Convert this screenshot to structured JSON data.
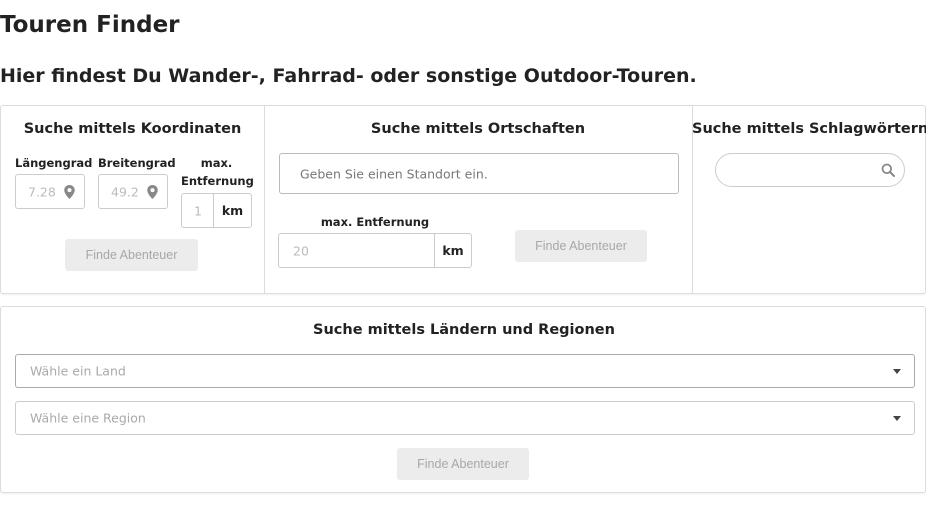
{
  "page": {
    "title": "Touren Finder",
    "subtitle": "Hier findest Du Wander-, Fahrrad- oder sonstige Outdoor-Touren."
  },
  "coordinates": {
    "title": "Suche mittels Koordinaten",
    "longitude_label": "Längengrad",
    "longitude_placeholder": "7.28",
    "latitude_label": "Breitengrad",
    "latitude_placeholder": "49.2",
    "distance_label": "max. Entfernung",
    "distance_placeholder": "1",
    "unit": "km",
    "button": "Finde Abenteuer"
  },
  "places": {
    "title": "Suche mittels Ortschaften",
    "location_placeholder": "Geben Sie einen Standort ein.",
    "distance_label": "max. Entfernung",
    "distance_placeholder": "20",
    "unit": "km",
    "button": "Finde Abenteuer"
  },
  "keywords": {
    "title": "Suche mittels Schlagwörtern",
    "search_value": ""
  },
  "regions": {
    "title": "Suche mittels Ländern und Regionen",
    "country_placeholder": "Wähle ein Land",
    "region_placeholder": "Wähle eine Region",
    "button": "Finde Abenteuer"
  },
  "icons": {
    "location": "map-pin-icon",
    "search": "search-icon",
    "dropdown": "caret-down-icon"
  },
  "colors": {
    "button_bg": "#ececec",
    "button_text": "#a8a8a8",
    "border": "#cccccc"
  }
}
